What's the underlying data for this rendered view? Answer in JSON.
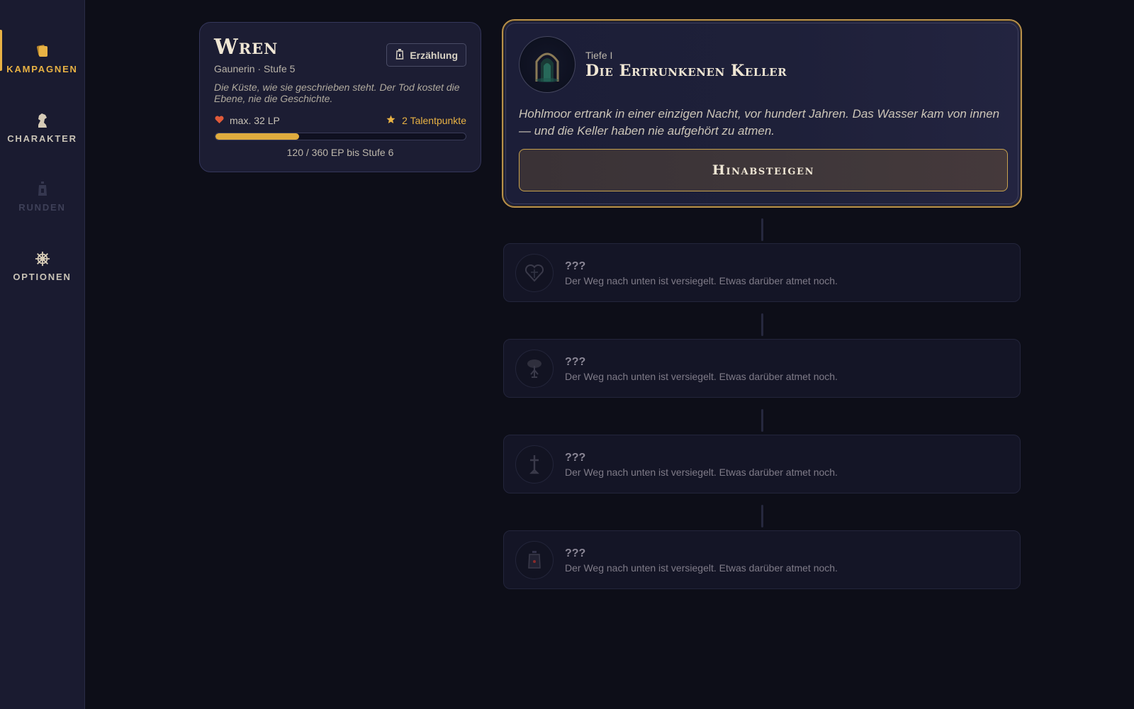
{
  "sidebar": {
    "items": [
      {
        "label": "Kampagnen",
        "icon": "cards-icon",
        "state": "active"
      },
      {
        "label": "Charakter",
        "icon": "chess-knight-icon",
        "state": "normal"
      },
      {
        "label": "Runden",
        "icon": "lantern-icon",
        "state": "disabled"
      },
      {
        "label": "Optionen",
        "icon": "ships-wheel-icon",
        "state": "normal"
      }
    ]
  },
  "character": {
    "name": "Wren",
    "subtitle": "Gaunerin · Stufe 5",
    "quote": "Die Küste, wie sie geschrieben steht. Der Tod kostet die Ebene, nie die Geschichte.",
    "mode_label": "Erzählung",
    "hp_label": "max. 32 LP",
    "talent_label": "2 Talentpunkte",
    "xp_current": 120,
    "xp_max": 360,
    "xp_fraction": 0.333,
    "xp_text": "120 / 360 EP bis Stufe 6"
  },
  "active_depth": {
    "tag": "Tiefe I",
    "title": "Die Ertrunkenen Keller",
    "description": "Hohlmoor ertrank in einer einzigen Nacht, vor hundert Jahren. Das Wasser kam von innen — und die Keller haben nie aufgehört zu atmen.",
    "button_label": "Hinabsteigen"
  },
  "locked_depths": [
    {
      "title": "???",
      "description": "Der Weg nach unten ist versiegelt. Etwas darüber atmet noch.",
      "icon": "heart-emblem-icon"
    },
    {
      "title": "???",
      "description": "Der Weg nach unten ist versiegelt. Etwas darüber atmet noch.",
      "icon": "tree-emblem-icon"
    },
    {
      "title": "???",
      "description": "Der Weg nach unten ist versiegelt. Etwas darüber atmet noch.",
      "icon": "sword-emblem-icon"
    },
    {
      "title": "???",
      "description": "Der Weg nach unten ist versiegelt. Etwas darüber atmet noch.",
      "icon": "lantern-emblem-icon"
    }
  ],
  "colors": {
    "accent": "#e8b244",
    "background": "#0d0e18",
    "sidebar": "#1a1b30",
    "card": "#1c1d33",
    "heart": "#e05a3a"
  }
}
